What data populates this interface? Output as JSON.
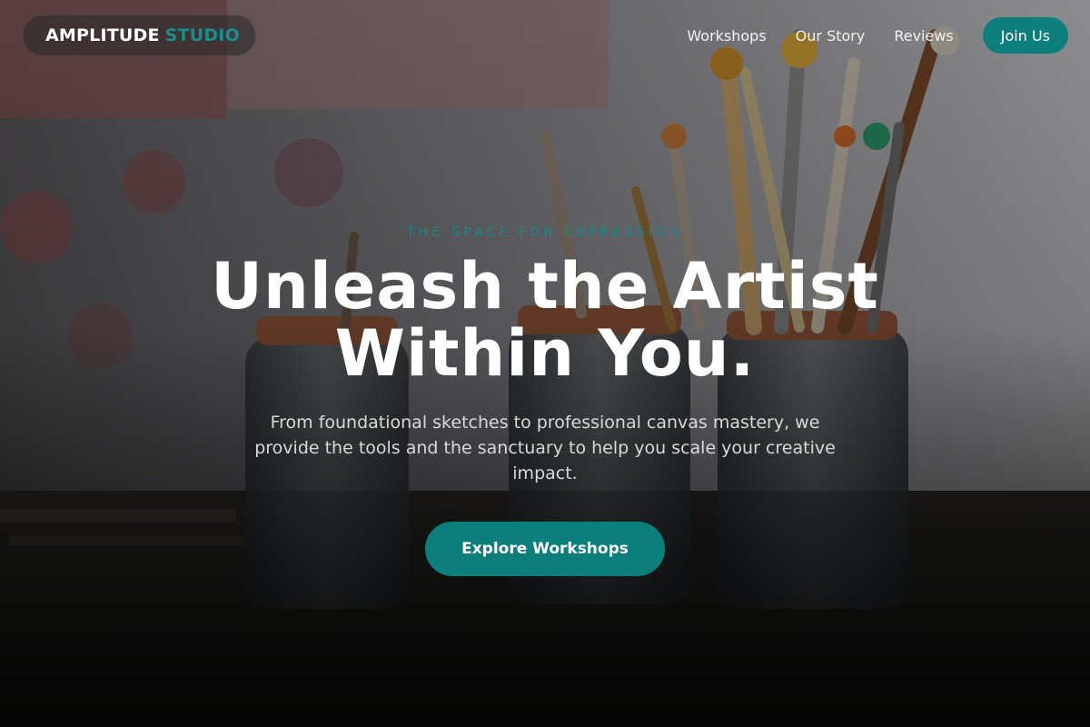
{
  "nav": {
    "brand_primary": "AMPLITUDE",
    "brand_accent": "STUDIO",
    "links": [
      "Workshops",
      "Our Story",
      "Reviews"
    ],
    "cta_label": "Join Us"
  },
  "hero": {
    "eyebrow": "THE SPACE FOR EXPRESSION",
    "headline_line1": "Unleash the Artist",
    "headline_line2": "Within You.",
    "subcopy": "From foundational sketches to professional canvas mastery, we provide the tools and the sanctuary to help you scale your creative impact.",
    "cta_label": "Explore Workshops",
    "background_image": "paintbrushes-in-jars-photo"
  },
  "colors": {
    "accent": "#0c7f7d",
    "accent_text": "#14908e",
    "text_primary": "#ffffff",
    "text_secondary": "#d9d9d9"
  }
}
